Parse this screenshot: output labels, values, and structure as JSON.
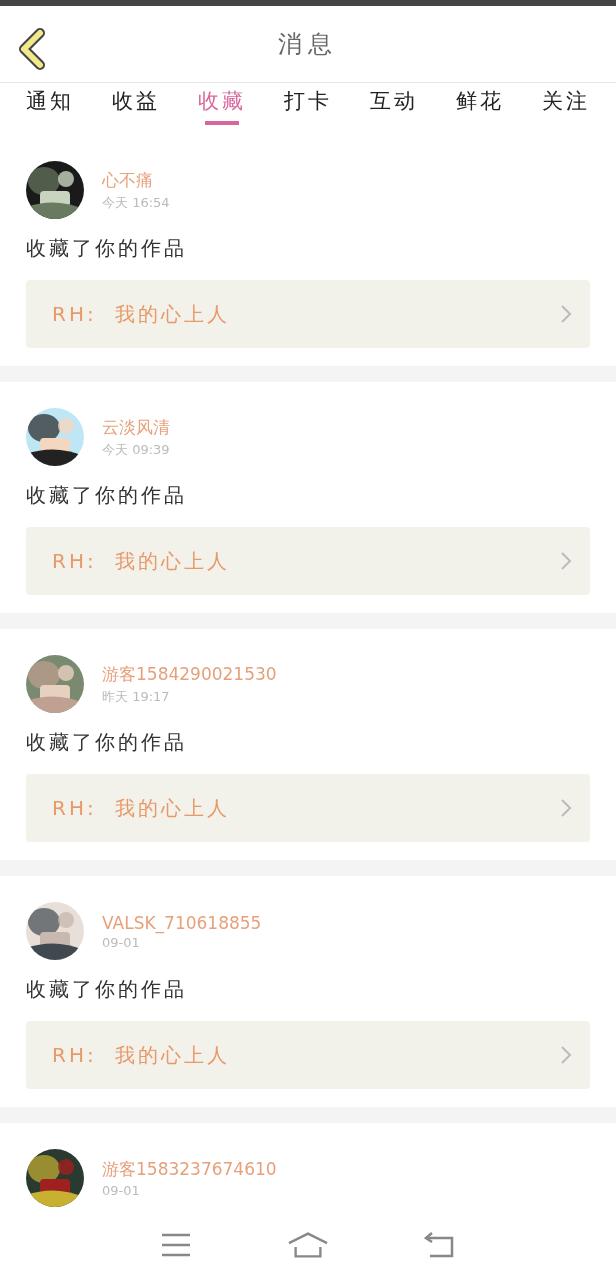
{
  "header": {
    "title": "消息"
  },
  "tabs": [
    {
      "label": "通知",
      "selected": false
    },
    {
      "label": "收益",
      "selected": false
    },
    {
      "label": "收藏",
      "selected": true
    },
    {
      "label": "打卡",
      "selected": false
    },
    {
      "label": "互动",
      "selected": false
    },
    {
      "label": "鲜花",
      "selected": false
    },
    {
      "label": "关注",
      "selected": false
    }
  ],
  "messages": [
    {
      "name": "心不痛",
      "time": "今天 16:54",
      "text": "收藏了你的作品",
      "work": {
        "prefix": "RH:",
        "title": "我的心上人"
      }
    },
    {
      "name": "云淡风清",
      "time": "今天 09:39",
      "text": "收藏了你的作品",
      "work": {
        "prefix": "RH:",
        "title": "我的心上人"
      }
    },
    {
      "name": "游客1584290021530",
      "time": "昨天 19:17",
      "text": "收藏了你的作品",
      "work": {
        "prefix": "RH:",
        "title": "我的心上人"
      }
    },
    {
      "name": "VALSK_710618855",
      "time": "09-01",
      "text": "收藏了你的作品",
      "work": {
        "prefix": "RH:",
        "title": "我的心上人"
      }
    },
    {
      "name": "游客1583237674610",
      "time": "09-01"
    }
  ]
}
